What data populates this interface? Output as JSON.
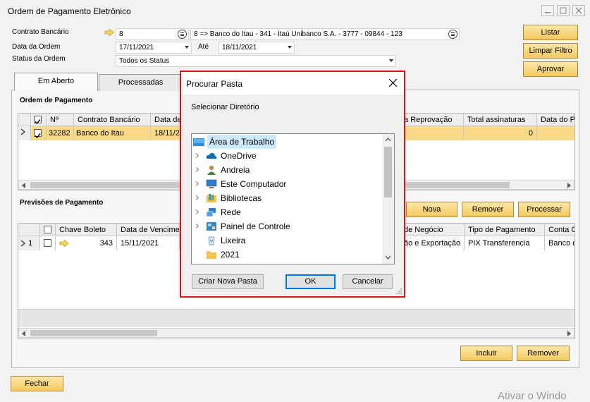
{
  "window": {
    "title": "Ordem de Pagamento Eletrônico"
  },
  "form": {
    "contrato_label": "Contrato Bancário",
    "contrato_value": "8",
    "contrato_desc": "8 => Banco do Itau - 341 - Itaú Unibanco  S.A. - 3777 - 09844 - 123",
    "data_label": "Data da Ordem",
    "data_from": "17/11/2021",
    "ate_label": "Até",
    "data_to": "18/11/2021",
    "status_label": "Status da Ordem",
    "status_value": "Todos os Status"
  },
  "buttons": {
    "listar": "Listar",
    "limpar": "Limpar Filtro",
    "aprovar": "Aprovar",
    "nova": "Nova",
    "remover": "Remover",
    "processar": "Processar",
    "incluir": "Incluir",
    "remover2": "Remover",
    "fechar": "Fechar"
  },
  "tabs": [
    "Em Aberto",
    "Processadas"
  ],
  "ordens": {
    "title": "Ordem de Pagamento",
    "headers": [
      "Nº",
      "Contrato Bancário",
      "Data de",
      "a Reprovação",
      "Total assinaturas",
      "Data do P"
    ],
    "row": {
      "num": "32282",
      "contrato": "Banco do Itau",
      "data": "18/11/2",
      "total": "0"
    }
  },
  "previsoes": {
    "title": "Previsões de Pagamento",
    "headers": [
      "Chave Boleto",
      "Data de Vencimen",
      "de Negócio",
      "Tipo de Pagamento",
      "Conta C"
    ],
    "row": {
      "index": "1",
      "chave": "343",
      "venc": "15/11/2021",
      "negocio": "ão e Exportação",
      "tipo": "PIX Transferencia",
      "conta": "Banco d"
    }
  },
  "dialog": {
    "title": "Procurar Pasta",
    "subtitle": "Selecionar Diretório",
    "items": [
      "Área de Trabalho",
      "OneDrive",
      "Andreia",
      "Este Computador",
      "Bibliotecas",
      "Rede",
      "Painel de Controle",
      "Lixeira",
      "2021"
    ],
    "btn_new": "Criar Nova Pasta",
    "btn_ok": "OK",
    "btn_cancel": "Cancelar"
  },
  "watermark": "Ativar o Windo"
}
